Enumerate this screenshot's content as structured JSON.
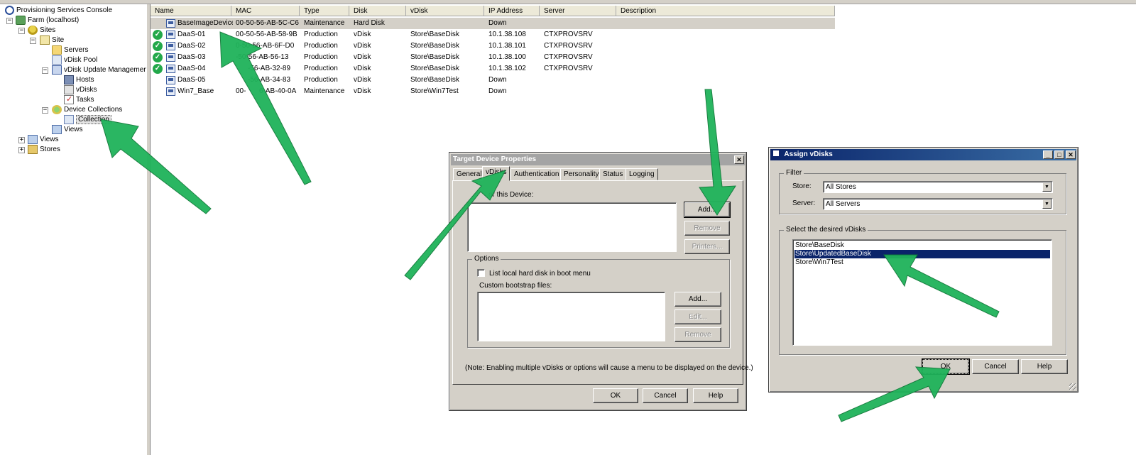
{
  "tree": {
    "root": "Provisioning Services Console",
    "farm": "Farm (localhost)",
    "sites": "Sites",
    "site": "Site",
    "servers": "Servers",
    "vdisk_pool": "vDisk Pool",
    "vdisk_update_mgmt": "vDisk Update Management",
    "hosts": "Hosts",
    "vdisks": "vDisks",
    "tasks": "Tasks",
    "device_collections": "Device Collections",
    "collection": "Collection",
    "site_views": "Views",
    "views": "Views",
    "stores": "Stores"
  },
  "list": {
    "columns": [
      "Name",
      "MAC",
      "Type",
      "Disk",
      "vDisk",
      "IP Address",
      "Server",
      "Description"
    ],
    "rows": [
      {
        "name": "BaseImageDevice",
        "mac": "00-50-56-AB-5C-C6",
        "type": "Maintenance",
        "disk": "Hard Disk",
        "vdisk": "",
        "ip": "Down",
        "server": "",
        "active": false
      },
      {
        "name": "DaaS-01",
        "mac": "00-50-56-AB-58-9B",
        "type": "Production",
        "disk": "vDisk",
        "vdisk": "Store\\BaseDisk",
        "ip": "10.1.38.108",
        "server": "CTXPROVSRV",
        "active": true
      },
      {
        "name": "DaaS-02",
        "mac": "0-50-56-AB-6F-D0",
        "type": "Production",
        "disk": "vDisk",
        "vdisk": "Store\\BaseDisk",
        "ip": "10.1.38.101",
        "server": "CTXPROVSRV",
        "active": true
      },
      {
        "name": "DaaS-03",
        "mac": "-50-56-AB-56-13",
        "type": "Production",
        "disk": "vDisk",
        "vdisk": "Store\\BaseDisk",
        "ip": "10.1.38.100",
        "server": "CTXPROVSRV",
        "active": true
      },
      {
        "name": "DaaS-04",
        "mac": "-56-AB-32-89",
        "type": "Production",
        "disk": "vDisk",
        "vdisk": "Store\\BaseDisk",
        "ip": "10.1.38.102",
        "server": "CTXPROVSRV",
        "active": true
      },
      {
        "name": "DaaS-05",
        "mac": "-56-AB-34-83",
        "type": "Production",
        "disk": "vDisk",
        "vdisk": "Store\\BaseDisk",
        "ip": "Down",
        "server": "",
        "active": false
      },
      {
        "name": "Win7_Base",
        "mac": "00-",
        "mac2": "6-AB-40-0A",
        "type": "Maintenance",
        "disk": "vDisk",
        "vdisk": "Store\\Win7Test",
        "ip": "Down",
        "server": "",
        "active": false
      }
    ]
  },
  "tdp": {
    "title": "Target Device Properties",
    "close": "✕",
    "tabs": [
      "General",
      "vDisks",
      "Authentication",
      "Personality",
      "Status",
      "Logging"
    ],
    "vdisks_label": "or this Device:",
    "add": "Add...",
    "remove": "Remove",
    "printers": "Printers...",
    "options_label": "Options",
    "list_local_hd": "List local hard disk in boot menu",
    "custom_bootstrap": "Custom bootstrap files:",
    "bs_add": "Add...",
    "bs_edit": "Edit...",
    "bs_remove": "Remove",
    "note": "(Note: Enabling multiple vDisks or options will cause a menu to be displayed on the device.)",
    "ok": "OK",
    "cancel": "Cancel",
    "help": "Help"
  },
  "assign": {
    "title": "Assign vDisks",
    "filter_label": "Filter",
    "store_label": "Store:",
    "store_value": "All Stores",
    "server_label": "Server:",
    "server_value": "All Servers",
    "select_label": "Select the desired vDisks",
    "items": [
      "Store\\BaseDisk",
      "Store\\UpdatedBaseDisk",
      "Store\\Win7Test"
    ],
    "ok": "OK",
    "cancel": "Cancel",
    "help": "Help"
  },
  "colors": {
    "arrow": "#1fb35a",
    "selection": "#0a246a",
    "dialog_face": "#d4d0c8"
  }
}
